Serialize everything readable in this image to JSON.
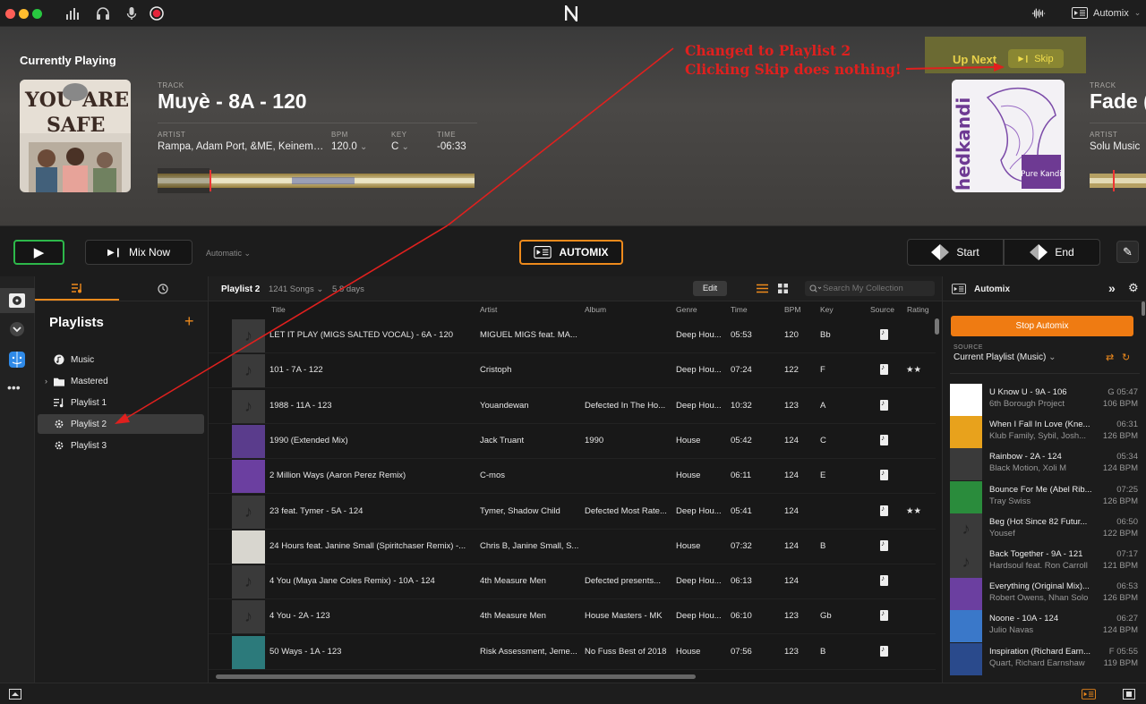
{
  "app": {
    "automix_menu_label": "Automix"
  },
  "now_playing": {
    "heading": "Currently Playing",
    "track_label": "TRACK",
    "track_title": "Muyè - 8A - 120",
    "artist_label": "ARTIST",
    "artist": "Rampa, Adam Port, &ME, Keinemu...",
    "bpm_label": "BPM",
    "bpm": "120.0",
    "key_label": "KEY",
    "key": "C",
    "time_label": "TIME",
    "time": "-06:33",
    "art_text": "YOU ARE SAFE"
  },
  "annotation": {
    "line1": "Changed to Playlist 2",
    "line2": "Clicking Skip does nothing!",
    "color": "#e0201e"
  },
  "up_next": {
    "label": "Up Next",
    "skip_label": "Skip",
    "track_label": "TRACK",
    "track_title": "Fade (",
    "artist_label": "ARTIST",
    "artist": "Solu Music",
    "art_brand": "hedkandi",
    "art_caption": "Pure Kandi"
  },
  "transport": {
    "mix_now_label": "Mix Now",
    "mode_label": "Automatic",
    "automix_label": "AUTOMIX",
    "start_label": "Start",
    "end_label": "End"
  },
  "sidebar": {
    "heading": "Playlists",
    "items": [
      {
        "label": "Music",
        "icon": "music-note-circle-icon"
      },
      {
        "label": "Mastered",
        "icon": "folder-icon"
      },
      {
        "label": "Playlist 1",
        "icon": "playlist-icon"
      },
      {
        "label": "Playlist 2",
        "icon": "gear-playlist-icon",
        "selected": true
      },
      {
        "label": "Playlist 3",
        "icon": "gear-playlist-icon"
      }
    ]
  },
  "list": {
    "playlist_name": "Playlist 2",
    "song_count": "1241 Songs",
    "duration": "5.8 days",
    "edit_label": "Edit",
    "search_placeholder": "Search My Collection",
    "columns": [
      "Title",
      "Artist",
      "Album",
      "Genre",
      "Time",
      "BPM",
      "Key",
      "Source",
      "Rating"
    ],
    "rows": [
      {
        "title": "LET IT PLAY (MIGS SALTED VOCAL) - 6A - 120",
        "artist": "MIGUEL MIGS feat. MA...",
        "album": "",
        "genre": "Deep Hou...",
        "time": "05:53",
        "bpm": "120",
        "key": "Bb",
        "rating": ""
      },
      {
        "title": "101 - 7A - 122",
        "artist": "Cristoph",
        "album": "",
        "genre": "Deep Hou...",
        "time": "07:24",
        "bpm": "122",
        "key": "F",
        "rating": "★★"
      },
      {
        "title": "1988 - 11A - 123",
        "artist": "Youandewan",
        "album": "Defected In The Ho...",
        "genre": "Deep Hou...",
        "time": "10:32",
        "bpm": "123",
        "key": "A",
        "rating": ""
      },
      {
        "title": "1990 (Extended Mix)",
        "artist": "Jack Truant",
        "album": "1990",
        "genre": "House",
        "time": "05:42",
        "bpm": "124",
        "key": "C",
        "rating": ""
      },
      {
        "title": "2 Million Ways (Aaron Perez Remix)",
        "artist": "C-mos",
        "album": "",
        "genre": "House",
        "time": "06:11",
        "bpm": "124",
        "key": "E",
        "rating": ""
      },
      {
        "title": "23 feat. Tymer - 5A - 124",
        "artist": "Tymer, Shadow Child",
        "album": "Defected Most Rate...",
        "genre": "Deep Hou...",
        "time": "05:41",
        "bpm": "124",
        "key": "",
        "rating": "★★"
      },
      {
        "title": "24 Hours feat. Janine Small (Spiritchaser Remix) -...",
        "artist": "Chris B, Janine Small, S...",
        "album": "",
        "genre": "House",
        "time": "07:32",
        "bpm": "124",
        "key": "B",
        "rating": ""
      },
      {
        "title": "4 You (Maya Jane Coles Remix) - 10A - 124",
        "artist": "4th Measure Men",
        "album": "Defected presents...",
        "genre": "Deep Hou...",
        "time": "06:13",
        "bpm": "124",
        "key": "",
        "rating": ""
      },
      {
        "title": "4 You - 2A - 123",
        "artist": "4th Measure Men",
        "album": "House Masters - MK",
        "genre": "Deep Hou...",
        "time": "06:10",
        "bpm": "123",
        "key": "Gb",
        "rating": ""
      },
      {
        "title": "50 Ways - 1A - 123",
        "artist": "Risk Assessment, Jeme...",
        "album": "No Fuss Best of 2018",
        "genre": "House",
        "time": "07:56",
        "bpm": "123",
        "key": "B",
        "rating": ""
      }
    ]
  },
  "automix_panel": {
    "title": "Automix",
    "stop_label": "Stop Automix",
    "source_label": "SOURCE",
    "source_value": "Current Playlist (Music)",
    "queue": [
      {
        "title": "U Know U - 9A - 106",
        "sub": "6th Borough Project",
        "r1": "G 05:47",
        "r2": "106 BPM"
      },
      {
        "title": "When I Fall In Love (Kne...",
        "sub": "Klub Family, Sybil, Josh...",
        "r1": "06:31",
        "r2": "126 BPM"
      },
      {
        "title": "Rainbow - 2A - 124",
        "sub": "Black Motion, Xoli M",
        "r1": "05:34",
        "r2": "124 BPM"
      },
      {
        "title": "Bounce For Me (Abel Rib...",
        "sub": "Tray Swiss",
        "r1": "07:25",
        "r2": "126 BPM"
      },
      {
        "title": "Beg (Hot Since 82 Futur...",
        "sub": "Yousef",
        "r1": "06:50",
        "r2": "122 BPM"
      },
      {
        "title": "Back Together - 9A - 121",
        "sub": "Hardsoul feat. Ron Carroll",
        "r1": "07:17",
        "r2": "121 BPM"
      },
      {
        "title": "Everything (Original Mix)...",
        "sub": "Robert Owens, Nhan Solo",
        "r1": "06:53",
        "r2": "126 BPM"
      },
      {
        "title": "Noone - 10A - 124",
        "sub": "Julio Navas",
        "r1": "06:27",
        "r2": "124 BPM"
      },
      {
        "title": "Inspiration (Richard Earn...",
        "sub": "Quart, Richard Earnshaw",
        "r1": "F 05:55",
        "r2": "119 BPM"
      }
    ]
  },
  "colors": {
    "accent_orange": "#ee8a1c",
    "play_green": "#2db84a",
    "skip_yellow": "#f2de4c"
  }
}
